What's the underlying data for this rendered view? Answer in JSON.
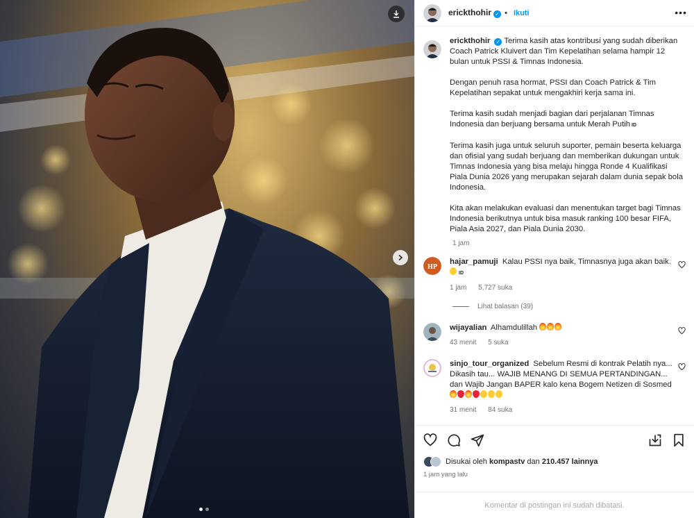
{
  "post": {
    "author": "erickthohir",
    "follow_label": "Ikuti",
    "more_label": "•••",
    "caption": [
      "Terima kasih atas kontribusi yang sudah diberikan Coach Patrick Kluivert dan Tim Kepelatihan selama hampir 12 bulan untuk PSSI & Timnas Indonesia.",
      "Dengan penuh rasa hormat, PSSI dan Coach Patrick & Tim Kepelatihan sepakat untuk mengakhiri kerja sama ini.",
      "Terima kasih sudah menjadi bagian dari perjalanan Timnas Indonesia dan berjuang bersama untuk Merah Putih",
      "Terima kasih juga untuk seluruh suporter, pemain beserta keluarga dan ofisial yang sudah berjuang dan memberikan dukungan untuk Timnas Indonesia yang bisa melaju hingga Ronde 4 Kualifikasi Piala Dunia 2026 yang merupakan sejarah dalam dunia sepak bola Indonesia.",
      "Kita akan melakukan evaluasi dan menentukan target bagi Timnas Indonesia berikutnya untuk bisa masuk ranking 100 besar FIFA, Piala Asia 2027, dan Piala Dunia 2030."
    ],
    "flag_text": "ID",
    "time": "1 jam"
  },
  "comments": [
    {
      "user": "hajar_pamuji",
      "text": "Kalau PSSI nya baik, Timnasnya juga akan baik.",
      "flag": "ID",
      "time": "1 jam",
      "likes": "5,727 suka",
      "replies": "Lihat balasan (39)"
    },
    {
      "user": "wijayalian",
      "text": "Alhamdulillah",
      "time": "43 menit",
      "likes": "5 suka"
    },
    {
      "user": "sinjo_tour_organized",
      "text": "Sebelum Resmi di kontrak Pelatih nya... Dikasih tau... WAJIB MENANG DI SEMUA PERTANDINGAN... dan Wajib Jangan BAPER kalo kena Bogem Netizen di Sosmed",
      "time": "31 menit",
      "likes": "84 suka"
    }
  ],
  "footer": {
    "liked_prefix": "Disukai oleh",
    "liked_user": "kompastv",
    "liked_and": "dan",
    "liked_count": "210.457 lainnya",
    "posted_ago": "1 jam yang lalu",
    "comments_closed": "Komentar di postingan ini sudah dibatasi."
  },
  "colors": {
    "accent": "#0095f6",
    "text": "#262626",
    "muted": "#737373"
  },
  "icons": [
    "download-icon",
    "chevron-right-icon",
    "verified-icon",
    "heart-icon",
    "comment-icon",
    "share-icon",
    "save-collection-icon",
    "bookmark-icon"
  ],
  "carousel": {
    "total": 2,
    "current": 1
  }
}
